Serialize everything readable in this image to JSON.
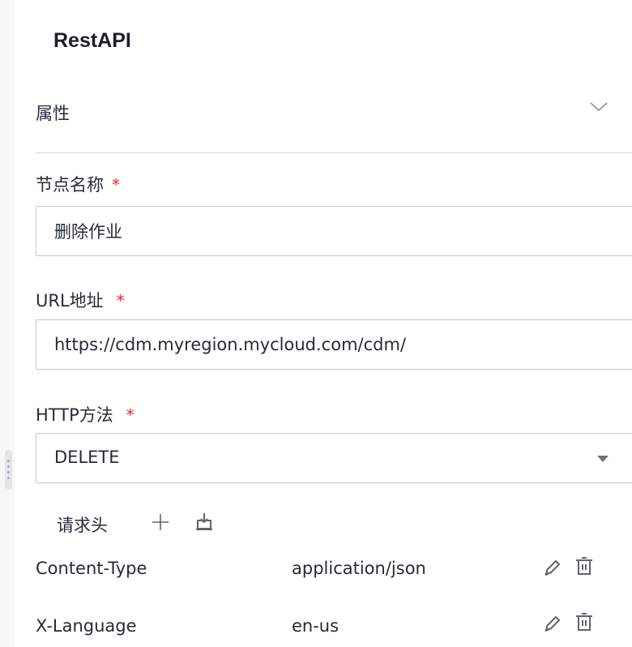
{
  "panel": {
    "title": "RestAPI"
  },
  "section": {
    "title": "属性",
    "toggle_icon": "chevron-down-icon"
  },
  "fields": {
    "node_name": {
      "label": "节点名称",
      "required_mark": "*",
      "value": "删除作业"
    },
    "url": {
      "label": "URL地址",
      "required_mark": "*",
      "value": "https://cdm.myregion.mycloud.com/cdm/"
    },
    "http_method": {
      "label": "HTTP方法",
      "required_mark": "*",
      "selected": "DELETE"
    }
  },
  "request_headers": {
    "title": "请求头",
    "add_icon": "plus-icon",
    "import_icon": "import-icon",
    "rows": [
      {
        "key": "Content-Type",
        "value": "application/json",
        "actions": [
          "edit-icon",
          "delete-icon"
        ]
      },
      {
        "key": "X-Language",
        "value": "en-us",
        "actions": [
          "edit-icon",
          "delete-icon"
        ]
      }
    ]
  },
  "colors": {
    "required": "#f5222d",
    "border": "#c3c7cf",
    "text": "#252b3a"
  }
}
